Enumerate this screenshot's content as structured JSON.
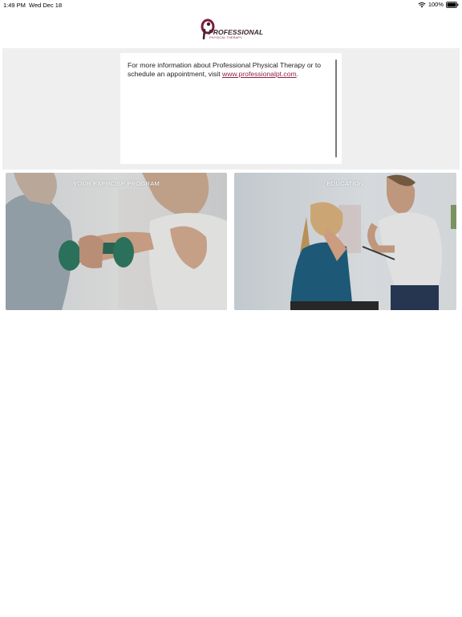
{
  "status_bar": {
    "time": "1:49 PM",
    "date": "Wed Dec 18",
    "battery": "100%",
    "icons": [
      "wifi-icon",
      "battery-icon"
    ]
  },
  "header": {
    "logo_word": "PROFESSIONAL",
    "logo_sub": "PHYSICAL THERAPY",
    "brand_color": "#7b1d3a"
  },
  "info": {
    "text_before": "For more information about Professional Physical Therapy or to schedule an appointment, visit ",
    "link_text": "www.professionalpt.com",
    "text_after": "."
  },
  "tiles": [
    {
      "label": "YOUR EXERCISE PROGRAM"
    },
    {
      "label": "EDUCATION"
    }
  ],
  "colors": {
    "link": "#8c2443",
    "band_bg": "#efefef"
  }
}
